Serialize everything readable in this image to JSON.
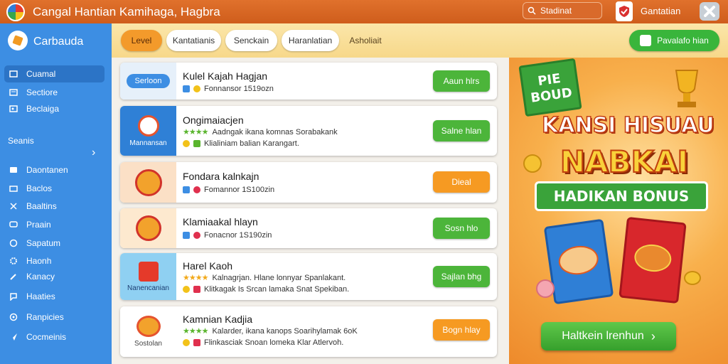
{
  "app": {
    "title": "Cangal Hantian  Kamihaga,  Hagbra",
    "search_placeholder": "Stadinat",
    "user_label": "Gantatian"
  },
  "sidebar": {
    "title": "Carbauda",
    "section_label": "Seanis",
    "items_top": [
      {
        "label": "Cuamal",
        "icon": "window-icon",
        "active": true
      },
      {
        "label": "Sectiore",
        "icon": "list-icon",
        "active": false
      },
      {
        "label": "Beclaiga",
        "icon": "image-icon",
        "active": false
      }
    ],
    "items_bottom": [
      {
        "label": "Daontanen",
        "icon": "card-icon"
      },
      {
        "label": "Baclos",
        "icon": "folder-icon"
      },
      {
        "label": "Baaltins",
        "icon": "tools-icon"
      },
      {
        "label": "Praain",
        "icon": "chat-icon"
      },
      {
        "label": "Sapatum",
        "icon": "box-icon"
      },
      {
        "label": "Haonh",
        "icon": "gear-icon"
      },
      {
        "label": "Kanacy",
        "icon": "pencil-icon"
      },
      {
        "label": "Haaties",
        "icon": "chat-bubble-icon"
      },
      {
        "label": "Ranpicies",
        "icon": "settings-icon"
      },
      {
        "label": "Cocmeinis",
        "icon": "send-icon"
      }
    ]
  },
  "filters": {
    "chips": [
      {
        "label": "Level",
        "active": true
      },
      {
        "label": "Kantatianis",
        "active": false
      },
      {
        "label": "Senckain",
        "active": false
      },
      {
        "label": "Haranlatian",
        "active": false
      }
    ],
    "extra_label": "Asholiait",
    "promo_button": "Pavalafo hian"
  },
  "cards": [
    {
      "thumb_pill": "Serloon",
      "title": "Kulel Kajah Hagjan",
      "line1": "Fonnansor 1519ozn",
      "line2": "",
      "button": "Aaun hlrs",
      "button_color": "green"
    },
    {
      "thumb_label": "Mannansan",
      "title": "Ongimaiacjen",
      "line1": "Aadngak ikana komnas Sorabakank",
      "line2": "Klialiniam balian Karangart.",
      "button": "Salne hlan",
      "button_color": "green"
    },
    {
      "thumb_label": "",
      "title": "Fondara kalnkajn",
      "line1": "Fomannor 1S100zin",
      "line2": "",
      "button": "Dieal",
      "button_color": "orange"
    },
    {
      "thumb_label": "",
      "title": "Klamiaakal hlayn",
      "line1": "Fonacnor 1S190zin",
      "line2": "",
      "button": "Sosn hlo",
      "button_color": "green"
    },
    {
      "thumb_label": "Nanencanian",
      "title": "Harel Kaoh",
      "line1": "Kalnagrjan. Hlane lonnyar Spanlakant.",
      "line2": "Klitkagak Is Srcan lamaka Snat Spekiban.",
      "button": "Sajlan bhg",
      "button_color": "green"
    },
    {
      "thumb_label": "Sostolan",
      "title": "Kamnian Kadjia",
      "line1": "Kalarder, ikana kanops Soarihylamak 6oK",
      "line2": "Flinkasciak Snoan lomeka Klar Atlervoh.",
      "button": "Bogn hlay",
      "button_color": "orange"
    }
  ],
  "promo": {
    "board_text": "PIE BOUD",
    "arch_text": "KANSI HISUAU",
    "big_text": "NABKAI",
    "ribbon_text": "HADIKAN BONUS",
    "cta_label": "Haltkein lrenhun"
  },
  "colors": {
    "topbar": "#d9642a",
    "sidebar": "#3d8ee3",
    "accent_green": "#4cb53a",
    "accent_orange": "#f69a22"
  }
}
